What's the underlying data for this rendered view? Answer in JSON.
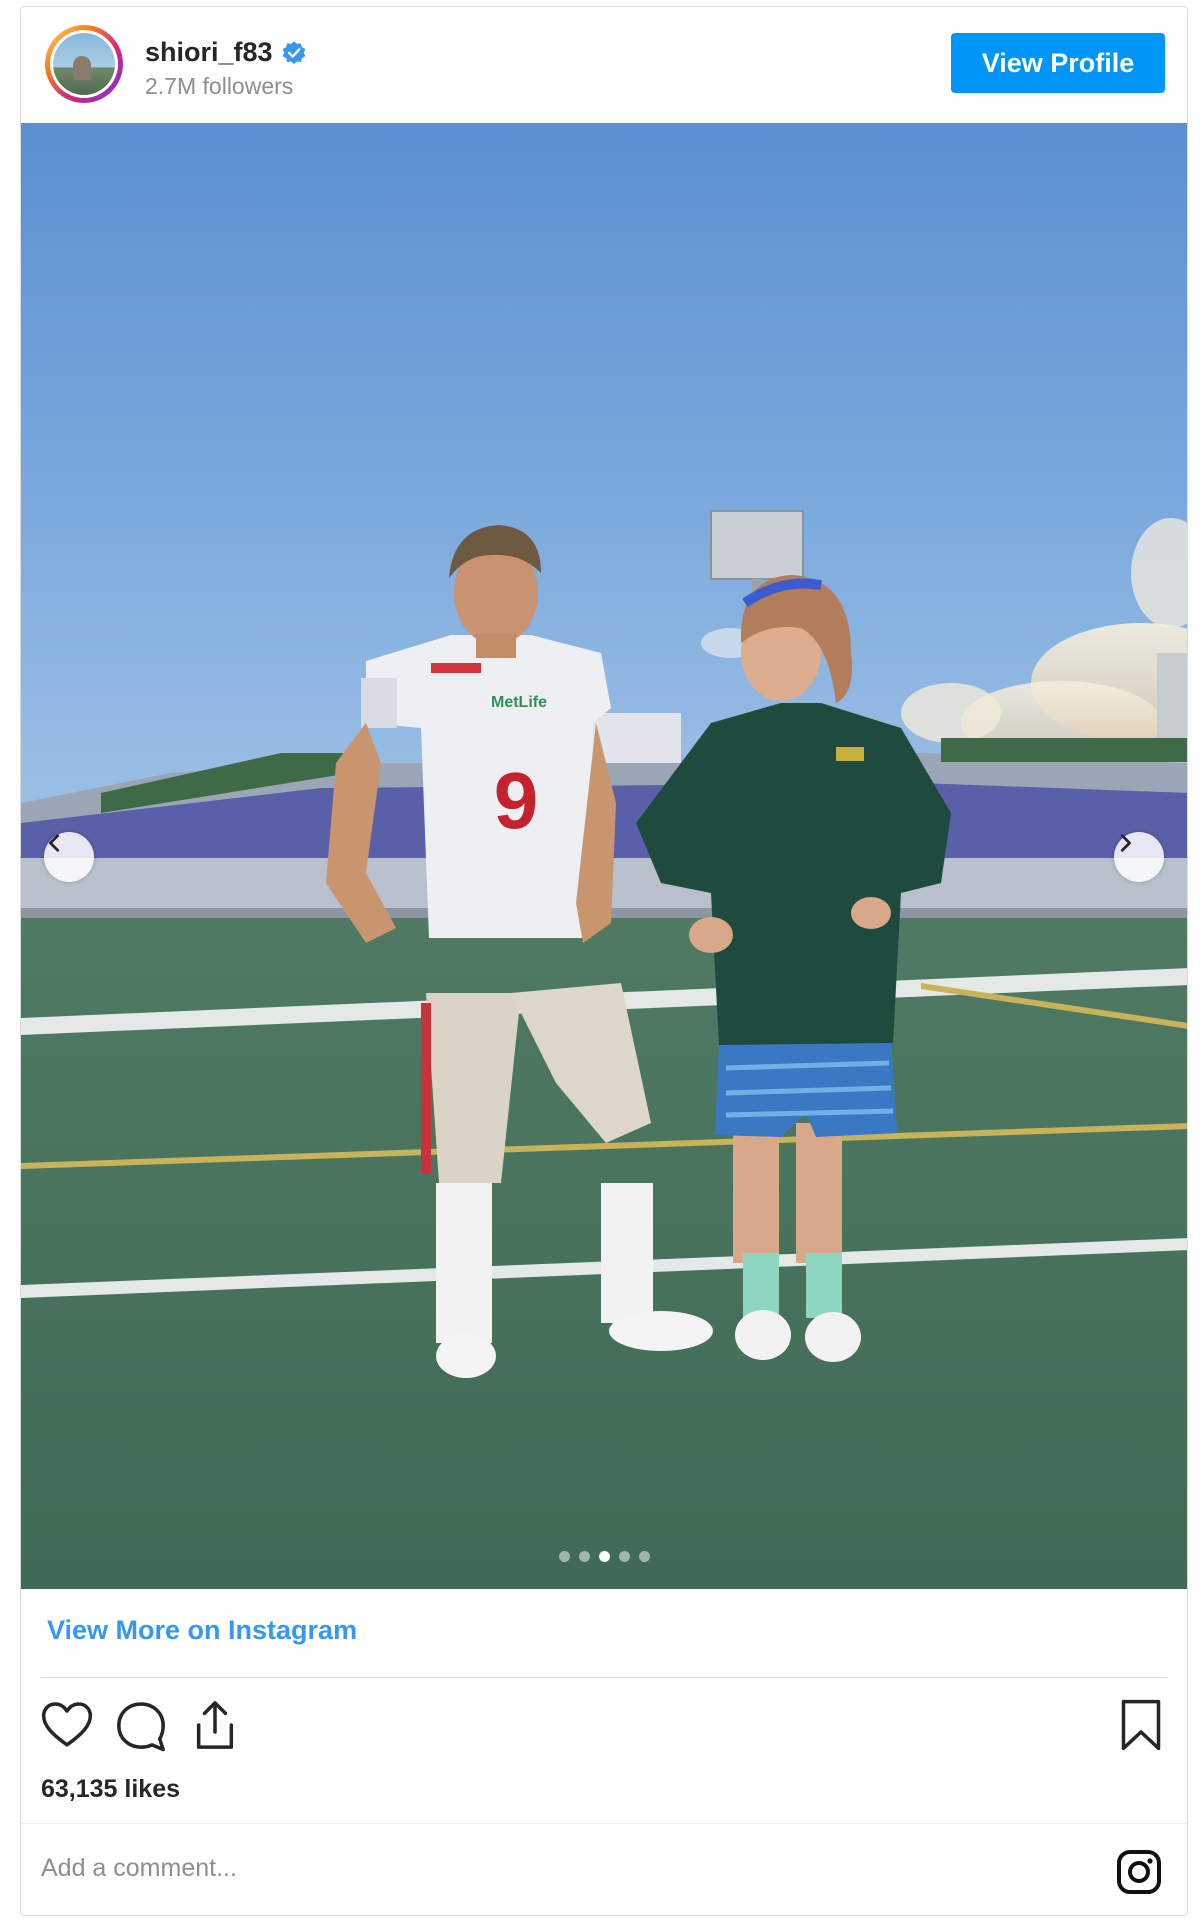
{
  "header": {
    "username": "shiori_f83",
    "followers": "2.7M followers",
    "view_profile_label": "View Profile"
  },
  "photo": {
    "jersey_number": "9",
    "sponsor_text": "MetLife",
    "carousel_total": 5,
    "carousel_active_index": 2
  },
  "footer": {
    "view_more_label": "View More on Instagram",
    "likes": "63,135 likes",
    "comment_placeholder": "Add a comment..."
  },
  "colors": {
    "accent": "#0095f6",
    "link": "#3897f0",
    "border": "#dbdbdb"
  },
  "icons": [
    "verified-badge-icon",
    "chevron-left-icon",
    "chevron-right-icon",
    "heart-icon",
    "comment-icon",
    "share-icon",
    "bookmark-icon",
    "instagram-icon"
  ]
}
